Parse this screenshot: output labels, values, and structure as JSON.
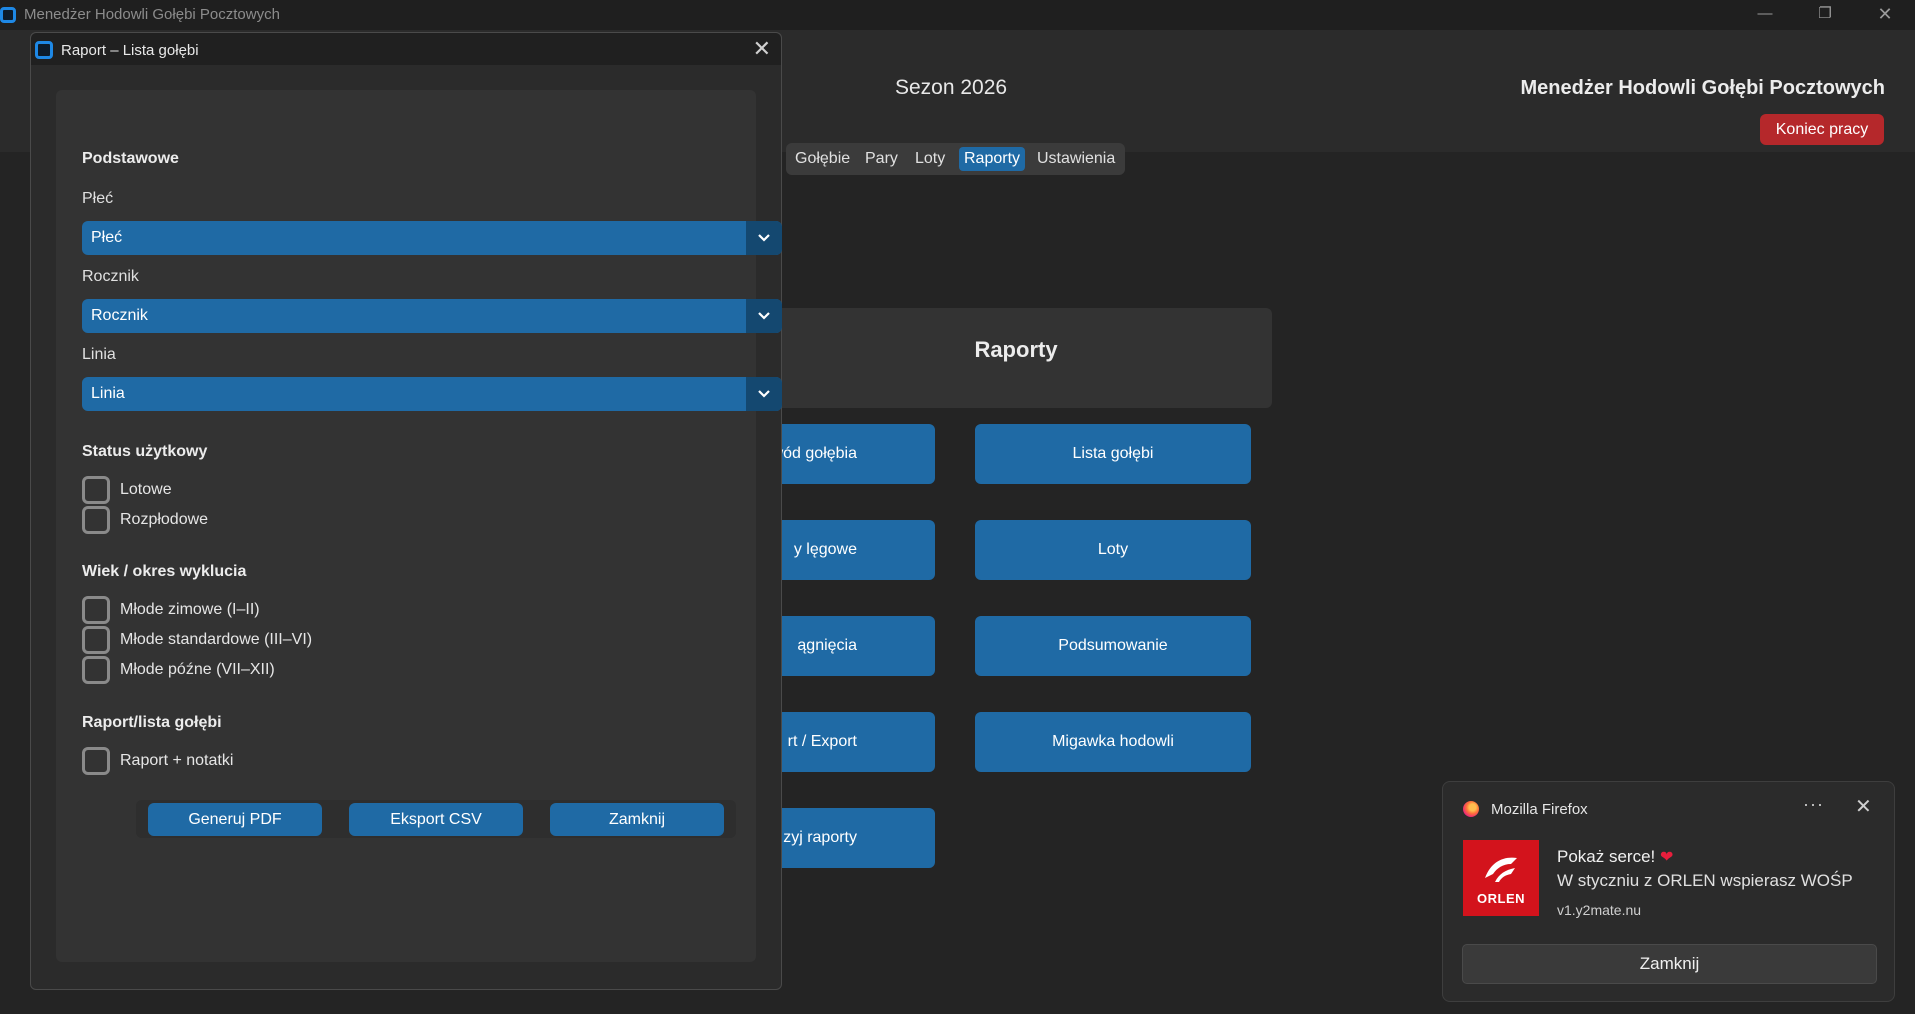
{
  "window": {
    "title": "Menedżer Hodowli Gołębi Pocztowych",
    "minimize": "—",
    "maximize": "❐",
    "close": "✕"
  },
  "header": {
    "season": "Sezon 2026",
    "app_name": "Menedżer Hodowli Gołębi Pocztowych",
    "end_button": "Koniec pracy",
    "accent_color": "#b5282b"
  },
  "tabs": [
    {
      "label": "Gołębie",
      "active": false
    },
    {
      "label": "Pary",
      "active": false
    },
    {
      "label": "Loty",
      "active": false
    },
    {
      "label": "Raporty",
      "active": true
    },
    {
      "label": "Ustawienia",
      "active": false
    }
  ],
  "reports": {
    "title": "Raporty",
    "left_buttons": [
      "wód gołębia",
      "y lęgowe",
      "ągnięcia",
      "rt / Export",
      "zyj raporty"
    ],
    "right_buttons": [
      "Lista gołębi",
      "Loty",
      "Podsumowanie",
      "Migawka hodowli"
    ]
  },
  "dialog": {
    "title": "Raport – Lista gołębi",
    "close": "✕",
    "section_basic": "Podstawowe",
    "sex_label": "Płeć",
    "sex_value": "Płeć",
    "year_label": "Rocznik",
    "year_value": "Rocznik",
    "line_label": "Linia",
    "line_value": "Linia",
    "section_status": "Status użytkowy",
    "status_options": [
      "Lotowe",
      "Rozpłodowe"
    ],
    "section_age": "Wiek / okres wyklucia",
    "age_options": [
      "Młode zimowe (I–II)",
      "Młode standardowe (III–VI)",
      "Młode późne (VII–XII)"
    ],
    "section_report": "Raport/lista gołębi",
    "report_options": [
      "Raport + notatki"
    ],
    "buttons": {
      "pdf": "Generuj PDF",
      "csv": "Eksport CSV",
      "close": "Zamknij"
    },
    "primary_color": "#1f6aa5"
  },
  "notification": {
    "app": "Mozilla Firefox",
    "more": "···",
    "close": "✕",
    "logo_text": "ORLEN",
    "title": "Pokaż serce!",
    "heart": "❤",
    "text": "W styczniu z ORLEN wspierasz WOŚP",
    "source": "v1.y2mate.nu",
    "button": "Zamknij"
  }
}
